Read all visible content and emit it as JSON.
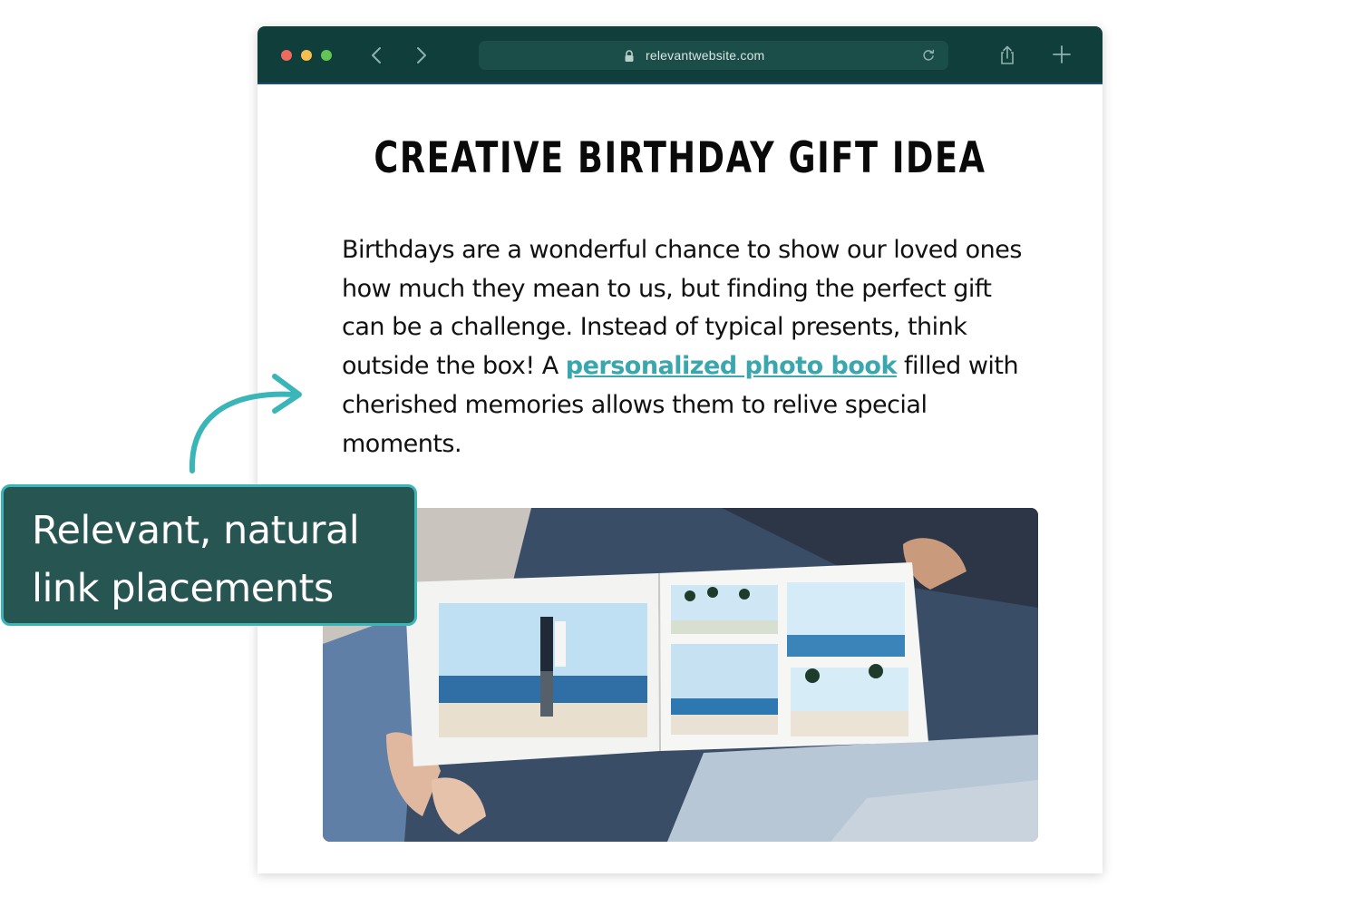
{
  "browser": {
    "url": "relevantwebsite.com"
  },
  "article": {
    "headline": "CREATIVE BIRTHDAY GIFT IDEA",
    "paragraph_before_link": "Birthdays are a wonderful chance to show our loved ones how much they mean to us, but finding the perfect gift can be a challenge. Instead of typical presents, think outside the box! A ",
    "link_text": "personalized photo book",
    "paragraph_after_link": " filled with cherished memories allows them to relive special moments."
  },
  "callout": {
    "text": "Relevant, natural link placements"
  },
  "colors": {
    "toolbar": "#0f3e3b",
    "link": "#3aa7ae",
    "callout_bg": "#265552",
    "callout_border": "#3ab5b8"
  },
  "icons": [
    "lock-icon",
    "back-arrow-icon",
    "forward-arrow-icon",
    "reload-icon",
    "share-icon",
    "plus-icon",
    "curved-arrow-icon"
  ]
}
